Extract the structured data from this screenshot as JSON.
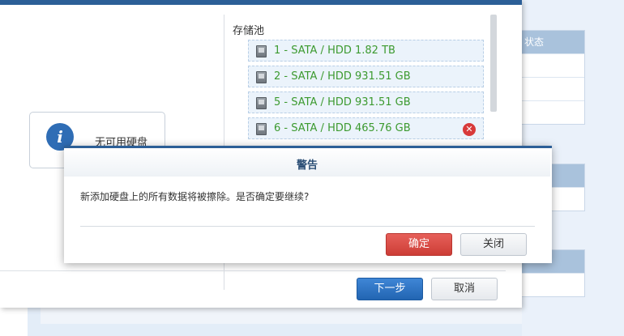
{
  "wizard": {
    "info_card": {
      "icon": "info-icon",
      "icon_glyph": "i",
      "text": "无可用硬盘"
    },
    "storage_pool": {
      "title": "存储池",
      "disks": [
        {
          "label": "1 - SATA / HDD 1.82 TB",
          "removable": false
        },
        {
          "label": "2 - SATA / HDD 931.51 GB",
          "removable": false
        },
        {
          "label": "5 - SATA / HDD 931.51 GB",
          "removable": false
        },
        {
          "label": "6 - SATA / HDD 465.76 GB",
          "removable": true
        }
      ],
      "remove_glyph": "✕"
    },
    "footer": {
      "next_label": "下一步",
      "cancel_label": "取消"
    }
  },
  "background": {
    "table_header": "状态"
  },
  "warning_dialog": {
    "title": "警告",
    "message": "新添加硬盘上的所有数据将被擦除。是否确定要继续?",
    "confirm_label": "确定",
    "close_label": "关闭"
  },
  "colors": {
    "accent": "#2c5f97",
    "disk_text": "#3c9a2f",
    "danger": "#d83a3a"
  }
}
